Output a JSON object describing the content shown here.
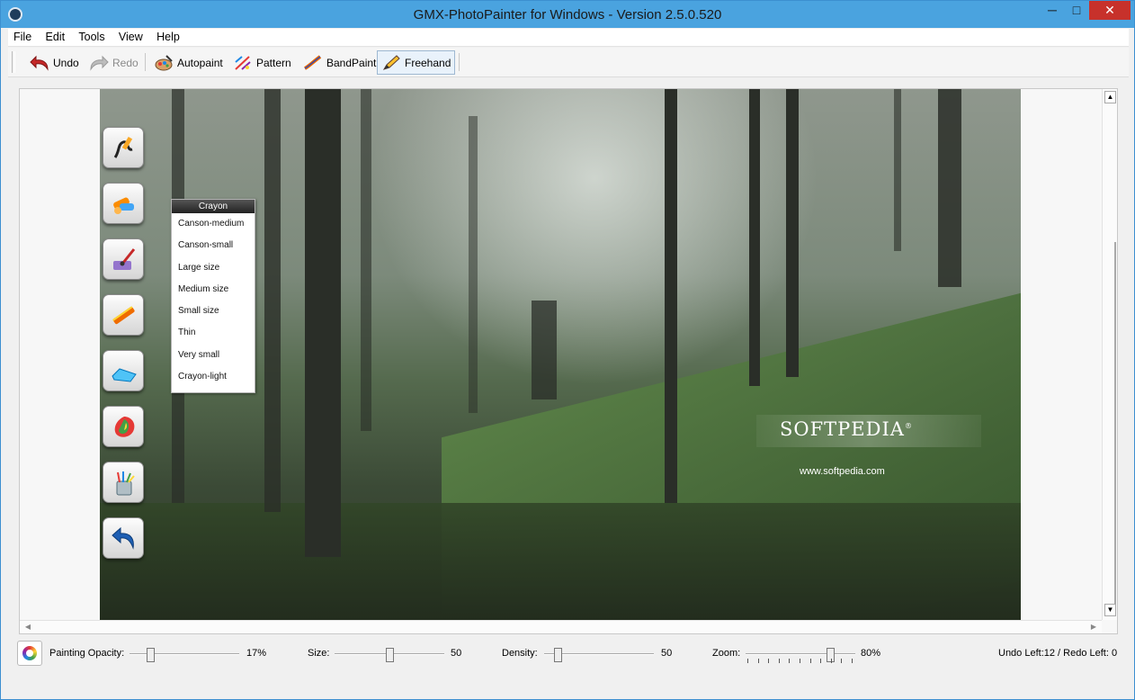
{
  "window": {
    "title": "GMX-PhotoPainter for Windows - Version 2.5.0.520",
    "minimize": "─",
    "maximize": "□",
    "close": "✕"
  },
  "menu": [
    "File",
    "Edit",
    "Tools",
    "View",
    "Help"
  ],
  "toolbar": {
    "undo": "Undo",
    "redo": "Redo",
    "autopaint": "Autopaint",
    "pattern": "Pattern",
    "bandpaint": "BandPaint",
    "freehand": "Freehand"
  },
  "canvas": {
    "crayon_menu": {
      "header": "Crayon",
      "items": [
        "Canson-medium",
        "Canson-small",
        "Large size",
        "Medium size",
        "Small size",
        "Thin",
        "Very small",
        "Crayon-light"
      ]
    },
    "watermark": {
      "logo": "SOFTPEDIA",
      "logo_mark": "®",
      "url": "www.softpedia.com"
    },
    "side_tools": [
      "freehand-tool-icon",
      "crayon-tool-icon",
      "brush-tool-icon",
      "pastel-tool-icon",
      "eraser-tool-icon",
      "palette-tool-icon",
      "pencils-cup-icon",
      "undo-arrow-icon"
    ]
  },
  "status": {
    "painting_opacity_label": "Painting Opacity:",
    "painting_opacity_value": "17%",
    "painting_opacity_level": 0.17,
    "size_label": "Size:",
    "size_value": "50",
    "size_level": 0.5,
    "density_label": "Density:",
    "density_value": "50",
    "density_level": 0.1,
    "zoom_label": "Zoom:",
    "zoom_value": "80%",
    "zoom_level": 0.8,
    "undo_redo": "Undo Left:12 / Redo Left: 0"
  },
  "colors": {
    "titlebar": "#4aa3df",
    "close_button": "#c7312b",
    "undo_arrow": "#c62828"
  }
}
